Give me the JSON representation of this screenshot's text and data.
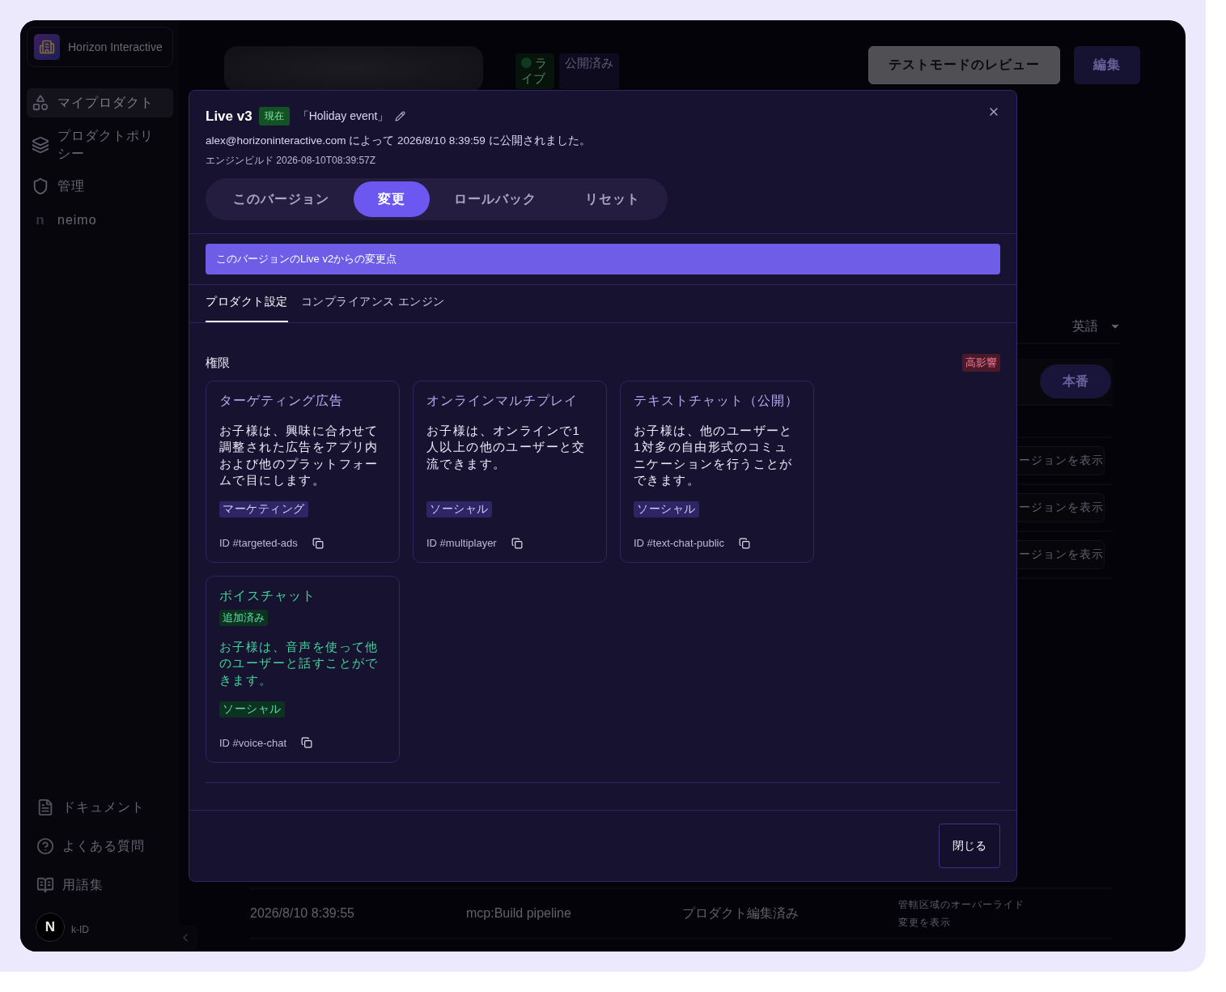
{
  "sidebar": {
    "brand": "Horizon Interactive",
    "nav": [
      {
        "label": "マイプロダクト",
        "selected": true
      },
      {
        "label": "プロダクトポリシー",
        "selected": false
      },
      {
        "label": "管理",
        "selected": false
      },
      {
        "label": "neimo",
        "icon_char": "n",
        "selected": false
      }
    ],
    "footer_links": [
      {
        "label": "ドキュメント"
      },
      {
        "label": "よくある質問"
      },
      {
        "label": "用語集"
      }
    ],
    "account": {
      "avatar_letter": "N",
      "name": "k-ID"
    }
  },
  "header": {
    "status_badges": [
      {
        "label": "ライブ",
        "kind": "live"
      },
      {
        "label": "公開済み",
        "kind": "plain"
      }
    ],
    "buttons": [
      {
        "label": "テストモードのレビュー",
        "kind": "secondary"
      },
      {
        "label": "編集",
        "kind": "primary"
      }
    ]
  },
  "language_select": {
    "value": "英語"
  },
  "environment_pill": "本番",
  "version_buttons": [
    "ージョンを表示",
    "ージョンを表示",
    "ージョンを表示"
  ],
  "history_row": {
    "time": "2026/8/10 8:39:55",
    "actor": "mcp:Build pipeline",
    "action": "プロダクト編集済み",
    "note": "管轄区域のオーバーライド",
    "link": "変更を表示"
  },
  "modal": {
    "title": "Live v3",
    "current_badge": "現在",
    "event_name": "「Holiday event」",
    "published_line": "alex@horizoninteractive.com によって 2026/8/10 8:39:59 に公開されました。",
    "engine_build": "エンジンビルド 2026-08-10T08:39:57Z",
    "tabs": [
      {
        "label": "このバージョン",
        "selected": false
      },
      {
        "label": "変更",
        "selected": true
      },
      {
        "label": "ロールバック",
        "selected": false
      },
      {
        "label": "リセット",
        "selected": false
      }
    ],
    "change_banner": "このバージョンのLive v2からの変更点",
    "subtabs": [
      {
        "label": "プロダクト設定",
        "selected": true
      },
      {
        "label": "コンプライアンス エンジン",
        "selected": false
      }
    ],
    "section": {
      "title": "権限",
      "impact_badge": "高影響",
      "cards": [
        {
          "kind": "unchanged",
          "title": "ターゲティング広告",
          "description": "お子様は、興味に合わせて調整された広告をアプリ内および他のプラットフォームで目にします。",
          "tag": "マーケティング",
          "id": "ID #targeted-ads"
        },
        {
          "kind": "unchanged",
          "title": "オンラインマルチプレイ",
          "description": "お子様は、オンラインで1人以上の他のユーザーと交流できます。",
          "tag": "ソーシャル",
          "id": "ID #multiplayer"
        },
        {
          "kind": "unchanged",
          "title": "テキストチャット（公開）",
          "description": "お子様は、他のユーザーと1対多の自由形式のコミュニケーションを行うことができます。",
          "tag": "ソーシャル",
          "id": "ID #text-chat-public"
        },
        {
          "kind": "added",
          "title": "ボイスチャット",
          "status": "追加済み",
          "description": "お子様は、音声を使って他のユーザーと話すことができます。",
          "tag": "ソーシャル",
          "id": "ID #voice-chat"
        }
      ]
    },
    "close_button": "閉じる"
  }
}
